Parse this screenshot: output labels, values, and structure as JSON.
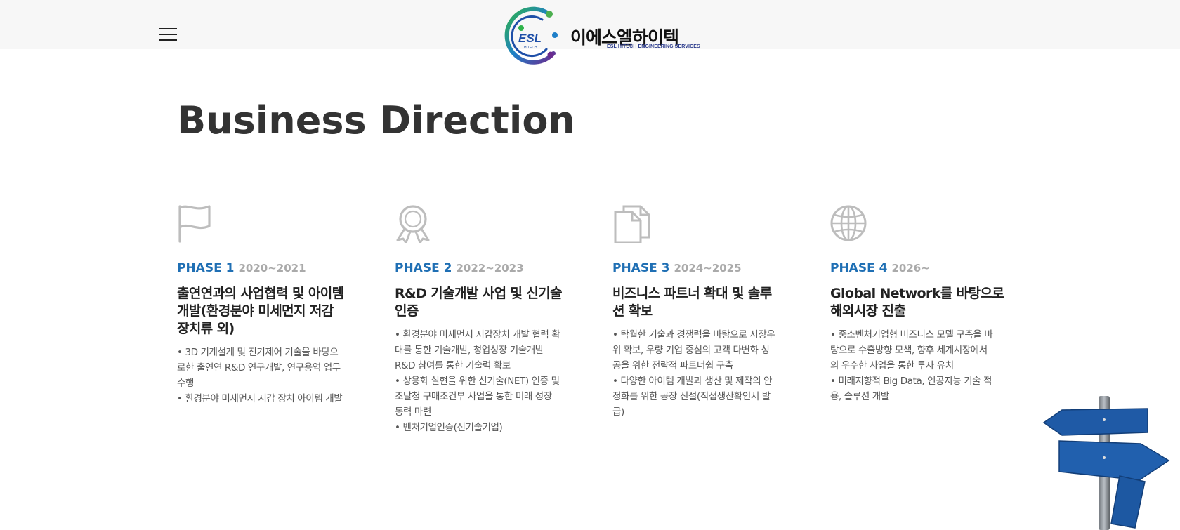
{
  "header": {
    "menu_icon": "hamburger-menu-icon",
    "logo_badge": "ESL",
    "logo_badge_sub": "HITECH",
    "logo_ko": "이에스엘하이텍",
    "logo_en": "ESL HITECH ENGINEERING SERVICES"
  },
  "page": {
    "title": "Business Direction"
  },
  "phases": [
    {
      "icon": "flag-icon",
      "label": "PHASE 1",
      "years": "2020~2021",
      "title_lines": [
        "출연연과의 사업협력 및 아이템",
        "개발(환경분야 미세먼지 저감",
        "장치류 외)"
      ],
      "desc_lines": [
        "• 3D 기계설계 및 전기제어 기술을 바탕으",
        "로한 출연연 R&D 연구개발, 연구용역 업무",
        "수행",
        "• 환경분야 미세먼지 저감 장치 아이템 개발"
      ]
    },
    {
      "icon": "award-ribbon-icon",
      "label": "PHASE 2",
      "years": "2022~2023",
      "title_lines": [
        "R&D 기술개발 사업 및 신기술",
        "인증"
      ],
      "desc_lines": [
        "• 환경분야 미세먼지 저감장치 개발 협력 확",
        "대를 통한 기술개발, 청업성장 기술개발",
        "R&D 참여를 통한 기술력 확보",
        "• 상용화 실현을 위한 신기술(NET) 인증 및",
        "조달청 구매조건부 사업을 통한 미래 성장",
        "동력 마련",
        "• 벤처기업인증(신기술기업)"
      ]
    },
    {
      "icon": "documents-icon",
      "label": "PHASE 3",
      "years": "2024~2025",
      "title_lines": [
        "비즈니스 파트너 확대 및 솔루",
        "션 확보"
      ],
      "desc_lines": [
        "• 탁월한 기술과 경쟁력을 바탕으로 시장우",
        "위 확보, 우량 기업 중심의 고객 다변화 성",
        "공을 위한 전략적 파트너쉽 구축",
        "• 다양한 아이템 개발과 생산 및 제작의 안",
        "정화를 위한 공장 신설(직접생산확인서 발",
        "급)"
      ]
    },
    {
      "icon": "globe-icon",
      "label": "PHASE 4",
      "years": "2026~",
      "title_lines": [
        "Global Network를 바탕으로",
        "해외시장 진출"
      ],
      "desc_lines": [
        "• 중소벤처기업형 비즈니스 모델 구축을 바",
        "탕으로 수출방향  모색, 향후 세계시장에서",
        "의 우수한 사업을 통한 투자 유치",
        "• 미래지향적 Big Data, 인공지능 기술 적",
        "용, 솔루션 개발"
      ]
    }
  ],
  "decor": {
    "image": "signpost-image"
  },
  "colors": {
    "phase_label": "#1f6fb4",
    "phase_years": "#aaaaaa",
    "icon_gray": "#bdbdbd",
    "title": "#333333",
    "topbar_bg": "#f7f7f7"
  }
}
